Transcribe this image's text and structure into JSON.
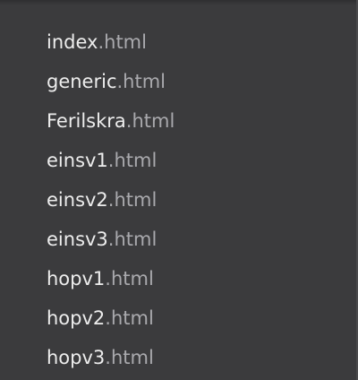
{
  "file_list": {
    "items": [
      {
        "name": "index",
        "ext": ".html"
      },
      {
        "name": "generic",
        "ext": ".html"
      },
      {
        "name": "Ferilskra",
        "ext": ".html"
      },
      {
        "name": "einsv1",
        "ext": ".html"
      },
      {
        "name": "einsv2",
        "ext": ".html"
      },
      {
        "name": "einsv3",
        "ext": ".html"
      },
      {
        "name": "hopv1",
        "ext": ".html"
      },
      {
        "name": "hopv2",
        "ext": ".html"
      },
      {
        "name": "hopv3",
        "ext": ".html"
      }
    ]
  },
  "colors": {
    "background": "#3b3b3d",
    "name_text": "#ededed",
    "ext_text": "#a9a9ad"
  }
}
